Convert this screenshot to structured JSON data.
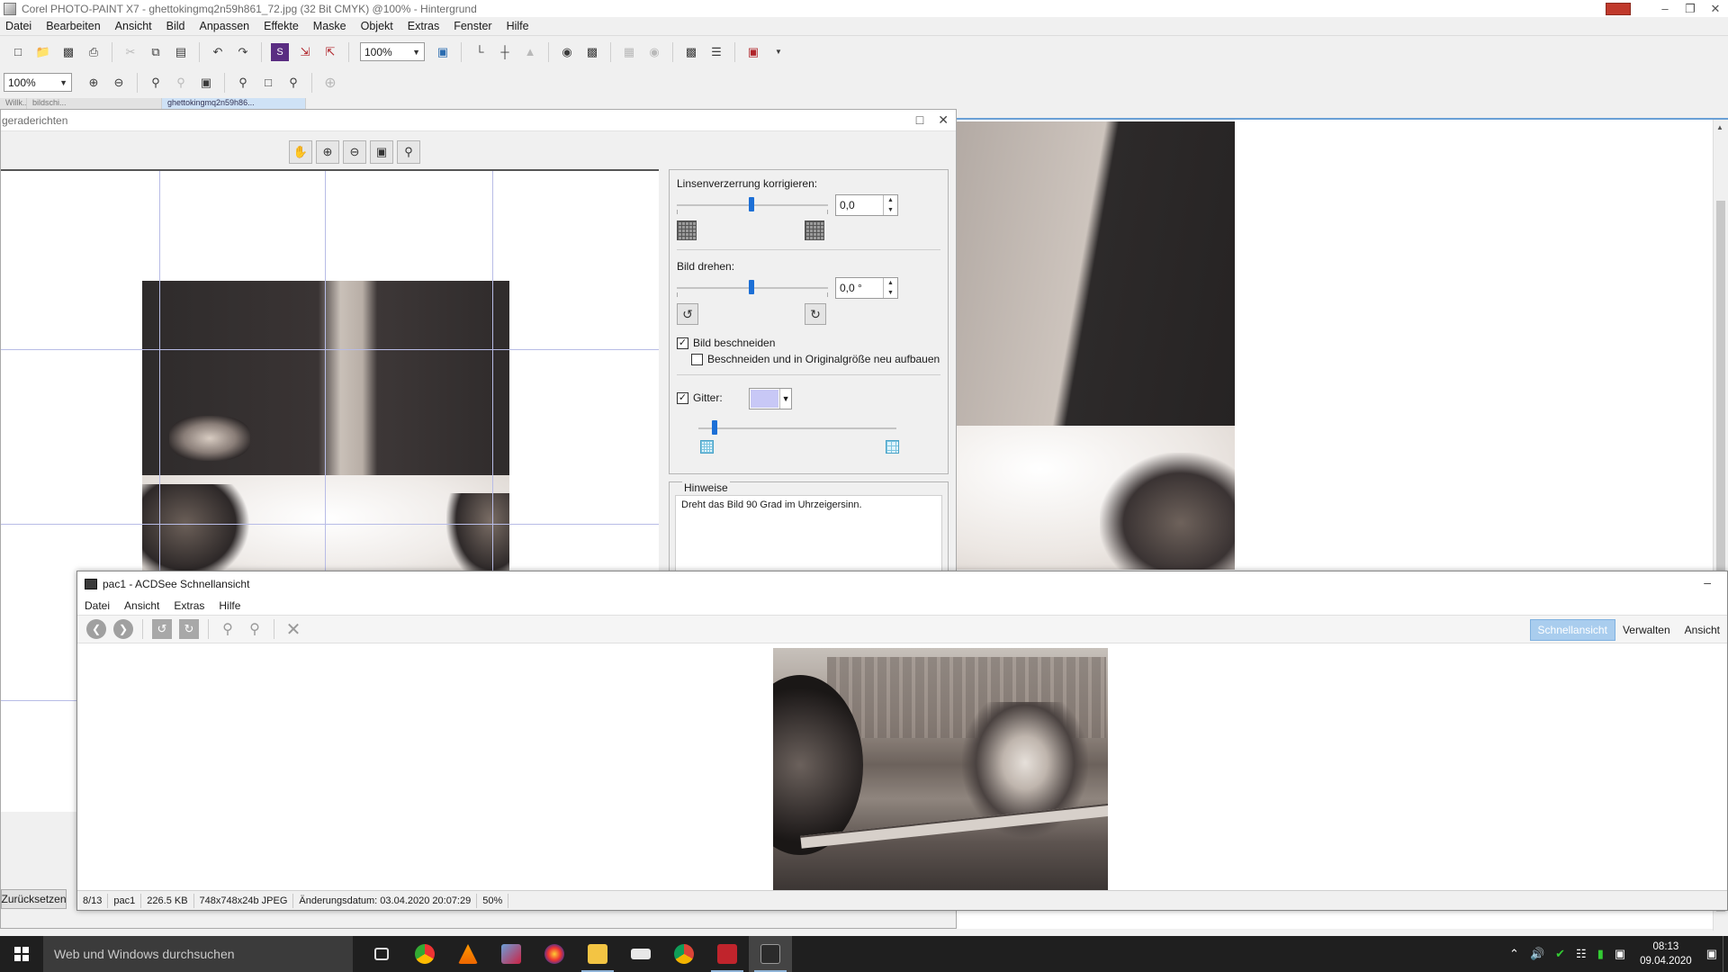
{
  "corel": {
    "title": "Corel PHOTO-PAINT X7 - ghettokingmq2n59h861_72.jpg (32 Bit CMYK) @100% - Hintergrund",
    "menu": [
      "Datei",
      "Bearbeiten",
      "Ansicht",
      "Bild",
      "Anpassen",
      "Effekte",
      "Maske",
      "Objekt",
      "Extras",
      "Fenster",
      "Hilfe"
    ],
    "zoom_toolbar": "100%",
    "zoom_view": "100%",
    "doc_tabs": [
      "Willk...",
      "bildschi...",
      "ghettokingmq2n59h86..."
    ]
  },
  "dialog": {
    "title": "geraderichten",
    "lens_label": "Linsenverzerrung korrigieren:",
    "lens_value": "0,0",
    "rotate_label": "Bild drehen:",
    "rotate_value": "0,0 °",
    "crop_label": "Bild beschneiden",
    "crop_checked": true,
    "crop_resize_label": "Beschneiden und in Originalgröße neu aufbauen",
    "crop_resize_checked": false,
    "grid_label": "Gitter:",
    "grid_checked": true,
    "grid_color": "#c8c8f6",
    "hints_title": "Hinweise",
    "hints_text": "Dreht das Bild 90 Grad im Uhrzeigersinn.",
    "reset_label": "Zurücksetzen"
  },
  "acdsee": {
    "title": "pac1 - ACDSee Schnellansicht",
    "menu": [
      "Datei",
      "Ansicht",
      "Extras",
      "Hilfe"
    ],
    "modes": [
      "Schnellansicht",
      "Verwalten",
      "Ansicht"
    ],
    "status": [
      "8/13",
      "pac1",
      "226.5 KB",
      "748x748x24b JPEG",
      "Änderungsdatum: 03.04.2020 20:07:29",
      "50%"
    ]
  },
  "taskbar": {
    "search_placeholder": "Web und Windows durchsuchen",
    "time": "08:13",
    "date": "09.04.2020"
  }
}
